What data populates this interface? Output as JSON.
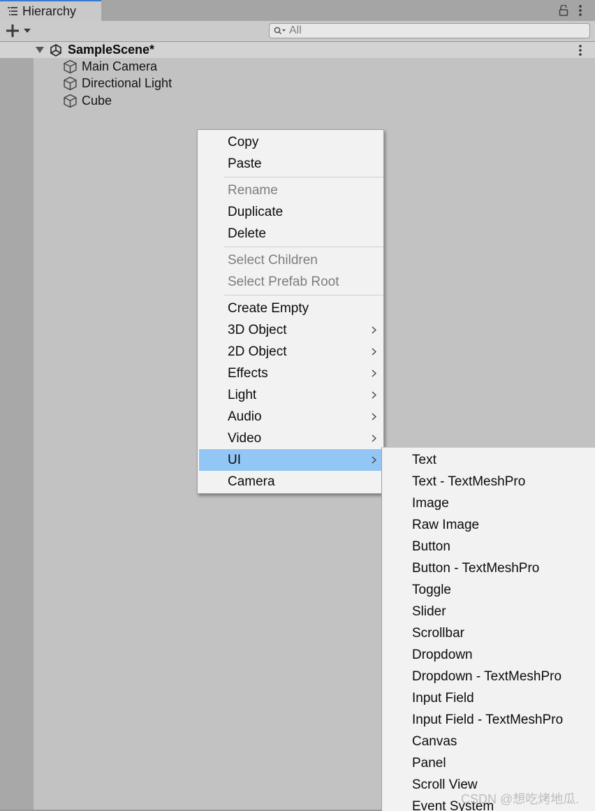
{
  "window": {
    "tab_title": "Hierarchy"
  },
  "search": {
    "placeholder": "All",
    "value": ""
  },
  "hierarchy": {
    "scene_name": "SampleScene*",
    "objects": [
      "Main Camera",
      "Directional Light",
      "Cube"
    ]
  },
  "context_menu": {
    "copy": "Copy",
    "paste": "Paste",
    "rename": "Rename",
    "duplicate": "Duplicate",
    "delete": "Delete",
    "select_children": "Select Children",
    "select_prefab_root": "Select Prefab Root",
    "create_empty": "Create Empty",
    "object_3d": "3D Object",
    "object_2d": "2D Object",
    "effects": "Effects",
    "light": "Light",
    "audio": "Audio",
    "video": "Video",
    "ui": "UI",
    "camera": "Camera"
  },
  "ui_submenu": [
    "Text",
    "Text - TextMeshPro",
    "Image",
    "Raw Image",
    "Button",
    "Button - TextMeshPro",
    "Toggle",
    "Slider",
    "Scrollbar",
    "Dropdown",
    "Dropdown - TextMeshPro",
    "Input Field",
    "Input Field - TextMeshPro",
    "Canvas",
    "Panel",
    "Scroll View",
    "Event System"
  ],
  "watermark": "CSDN @想吃烤地瓜.",
  "colors": {
    "highlight": "#92c6f5",
    "tab_accent": "#3a79d0",
    "menu_bg": "#f2f2f2"
  },
  "icons": {
    "tab": "hierarchy-list-icon",
    "lock": "lock-icon",
    "menu": "kebab-icon",
    "add": "plus-icon",
    "search": "search-icon",
    "scene": "unity-logo-icon",
    "gameobject": "cube-icon",
    "submenu": "chevron-right-icon"
  }
}
